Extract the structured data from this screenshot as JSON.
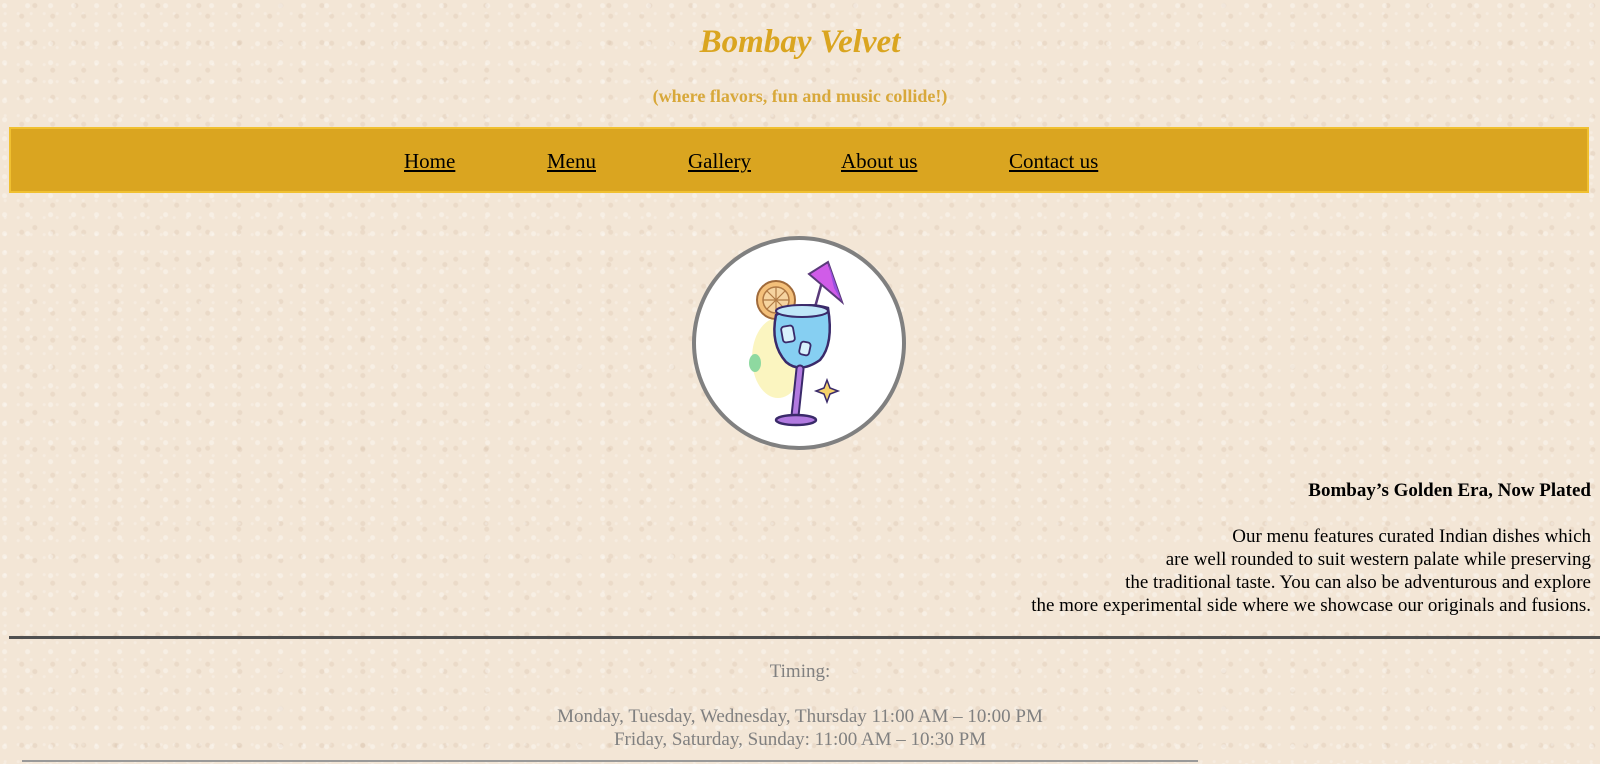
{
  "header": {
    "title": "Bombay Velvet",
    "tagline": "(where flavors, fun and music collide!)"
  },
  "nav": {
    "items": [
      "Home",
      "Menu",
      "Gallery",
      "About us",
      "Contact us"
    ]
  },
  "logo": {
    "icon": "cocktail-glass-icon"
  },
  "main": {
    "heading": "Bombay’s Golden Era, Now Plated",
    "description_lines": [
      "Our menu features curated Indian dishes which",
      "are well rounded to suit western palate while preserving",
      "the traditional taste. You can also be adventurous and explore",
      "the more experimental side where we showcase our originals and fusions."
    ]
  },
  "timing": {
    "label": "Timing:",
    "lines": [
      "Monday, Tuesday, Wednesday, Thursday 11:00 AM – 10:00 PM",
      "Friday, Saturday, Sunday: 11:00 AM – 10:30 PM"
    ]
  },
  "colors": {
    "brand": "#daa520",
    "background": "#f3e6d6",
    "text_muted": "#808080"
  }
}
